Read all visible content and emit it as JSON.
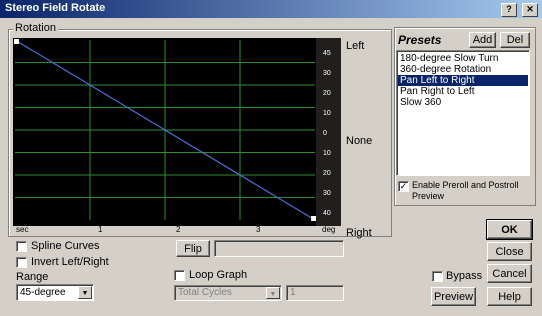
{
  "window": {
    "title": "Stereo Field Rotate",
    "close_glyph": "✕",
    "help_glyph": "?"
  },
  "rotation": {
    "group_label": "Rotation",
    "side_labels": {
      "left": "Left",
      "none": "None",
      "right": "Right"
    },
    "x_ticks": [
      "sec",
      "1",
      "2",
      "3",
      "deg"
    ],
    "y_scale": [
      "45",
      "30",
      "20",
      "10",
      "0",
      "10",
      "20",
      "30",
      "40"
    ],
    "curve": {
      "from_time": 0,
      "to_time": 4,
      "from_deg": 45,
      "to_deg": -45
    }
  },
  "options": {
    "spline_curves": "Spline Curves",
    "invert": "Invert Left/Right",
    "flip": "Flip",
    "loop_graph": "Loop Graph",
    "range_label": "Range",
    "range_value": "45-degree",
    "total_cycles": "Total Cycles",
    "cycles_value": "1"
  },
  "presets": {
    "label": "Presets",
    "add": "Add",
    "del": "Del",
    "items": [
      {
        "label": "180-degree Slow Turn",
        "selected": false
      },
      {
        "label": "360-degree Rotation",
        "selected": false
      },
      {
        "label": "Pan Left to Right",
        "selected": true
      },
      {
        "label": "Pan Right to Left",
        "selected": false
      },
      {
        "label": "Slow 360",
        "selected": false
      }
    ],
    "enable_preroll": "Enable Preroll and Postroll",
    "enable_preroll_2": "Preview",
    "enable_checked": "✓"
  },
  "buttons": {
    "ok": "OK",
    "close": "Close",
    "cancel": "Cancel",
    "bypass": "Bypass",
    "preview": "Preview",
    "help": "Help"
  },
  "colors": {
    "graph_bg": "#000000",
    "grid": "#2f8f2f",
    "curve": "#4a6fd4"
  }
}
